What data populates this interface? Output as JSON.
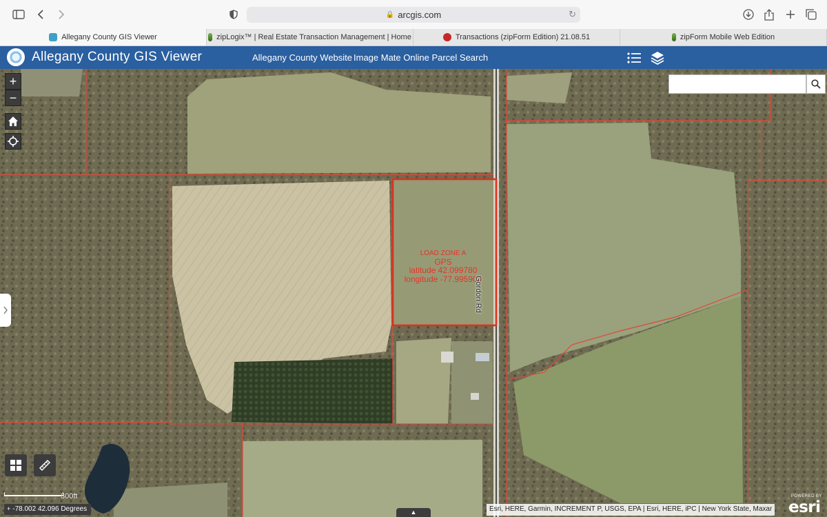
{
  "browser": {
    "address": "arcgis.com",
    "tabs": [
      {
        "label": "Allegany County GIS Viewer",
        "favicon": "gis-favicon"
      },
      {
        "label": "zipLogix™ | Real Estate Transaction Management | Home",
        "favicon": "ziplogix-favicon"
      },
      {
        "label": "Transactions (zipForm Edition) 21.08.51",
        "favicon": "transactions-favicon"
      },
      {
        "label": "zipForm Mobile Web Edition",
        "favicon": "ziplogix-favicon"
      }
    ]
  },
  "app": {
    "title": "Allegany County GIS Viewer",
    "links": [
      "Allegany County Website",
      "Image Mate Online Parcel Search"
    ],
    "header_color": "#2a5fa0"
  },
  "map": {
    "search_placeholder": "",
    "zoom_in": "+",
    "zoom_out": "−",
    "annotation": {
      "line1": "LOAD ZONE A",
      "line2": "GPS",
      "line3": "latitude 42.099780",
      "line4": "longitude -77.995904"
    },
    "road_label": "Gordon Rd",
    "scale_label": "300ft",
    "coordinates": "-78.002 42.096 Degrees",
    "attribution": "Esri, HERE, Garmin, INCREMENT P, USGS, EPA | Esri, HERE, iPC | New York State, Maxar",
    "esri_small": "POWERED BY",
    "esri_big": "esri",
    "parcel_color": "#e0483a",
    "highlight_color": "#e0301e"
  }
}
